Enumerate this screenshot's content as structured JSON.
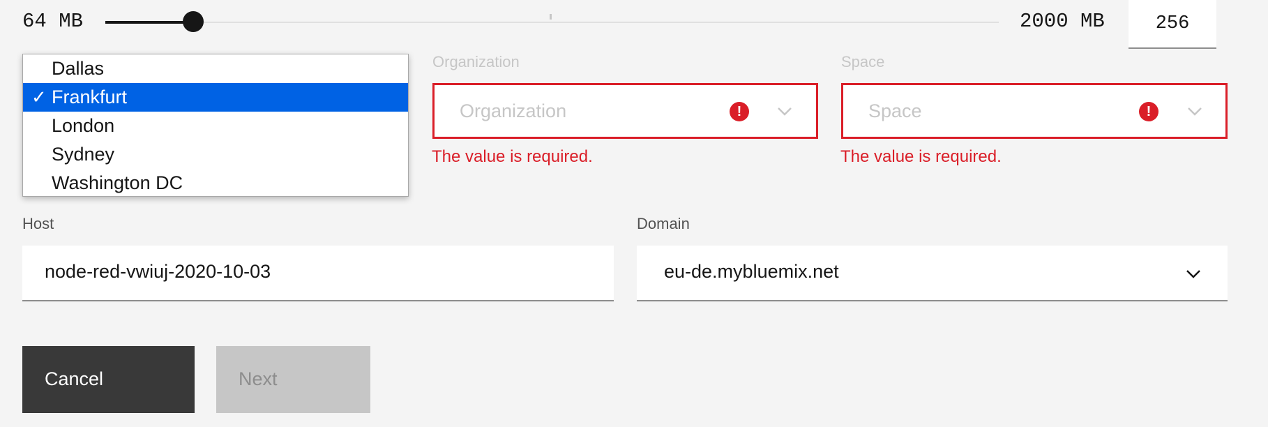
{
  "slider": {
    "min_label": "64 MB",
    "max_label": "2000 MB",
    "value": "256",
    "min": 64,
    "max": 2000
  },
  "region": {
    "options": [
      {
        "label": "Dallas",
        "selected": false
      },
      {
        "label": "Frankfurt",
        "selected": true
      },
      {
        "label": "London",
        "selected": false
      },
      {
        "label": "Sydney",
        "selected": false
      },
      {
        "label": "Washington DC",
        "selected": false
      }
    ],
    "check_glyph": "✓"
  },
  "organization": {
    "label": "Organization",
    "placeholder": "Organization",
    "error": "The value is required.",
    "error_icon": "!"
  },
  "space": {
    "label": "Space",
    "placeholder": "Space",
    "error": "The value is required.",
    "error_icon": "!"
  },
  "host": {
    "label": "Host",
    "value": "node-red-vwiuj-2020-10-03"
  },
  "domain": {
    "label": "Domain",
    "value": "eu-de.mybluemix.net"
  },
  "buttons": {
    "cancel": "Cancel",
    "next": "Next"
  },
  "colors": {
    "error": "#da1e28",
    "selected_option": "#0062e4",
    "primary_button": "#393939",
    "disabled_button": "#c6c6c6"
  }
}
